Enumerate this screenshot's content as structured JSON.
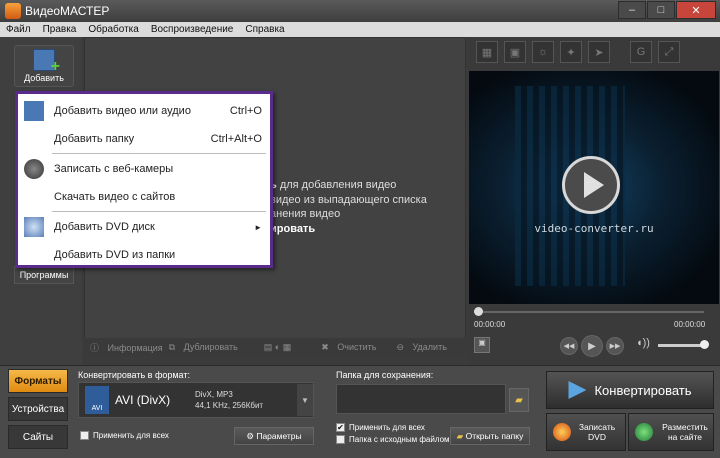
{
  "window": {
    "title": "ВидеоМАСТЕР"
  },
  "menubar": [
    "Файл",
    "Правка",
    "Обработка",
    "Воспроизведение",
    "Справка"
  ],
  "toolbar": {
    "add_label": "Добавить",
    "programs_label": "Программы"
  },
  "dropdown": {
    "items": [
      {
        "label": "Добавить видео или аудио",
        "shortcut": "Ctrl+O"
      },
      {
        "label": "Добавить папку",
        "shortcut": "Ctrl+Alt+O"
      },
      {
        "label": "Записать с веб-камеры",
        "shortcut": ""
      },
      {
        "label": "Скачать видео с сайтов",
        "shortcut": ""
      },
      {
        "label": "Добавить DVD диск",
        "shortcut": "►"
      },
      {
        "label": "Добавить DVD из папки",
        "shortcut": ""
      }
    ]
  },
  "hint": {
    "line1_bold": "ь",
    "line1": " для добавления видео",
    "line2": "видео из выпадающего списка",
    "line3": "анения видео",
    "line4_bold": "ировать"
  },
  "filebar": {
    "info": "Информация",
    "dup": "Дублировать",
    "clear": "Очистить",
    "delete": "Удалить"
  },
  "preview": {
    "watermark": "video-converter.ru",
    "time_start": "00:00:00",
    "time_end": "00:00:00",
    "seek_fraction": 0
  },
  "tabs": [
    "Форматы",
    "Устройства",
    "Сайты"
  ],
  "format": {
    "label": "Конвертировать в формат:",
    "badge": "AVI",
    "name": "AVI (DivX)",
    "spec1": "DivX, MP3",
    "spec2": "44,1 KHz, 256Кбит",
    "apply_all": "Применить для всех",
    "params": "Параметры"
  },
  "save": {
    "label": "Папка для сохранения:",
    "apply_all": "Применить для всех",
    "source_folder": "Папка с исходным файлом",
    "open_folder": "Открыть папку"
  },
  "actions": {
    "convert": "Конвертировать",
    "burn_dvd": "Записать DVD",
    "publish": "Разместить на сайте"
  }
}
